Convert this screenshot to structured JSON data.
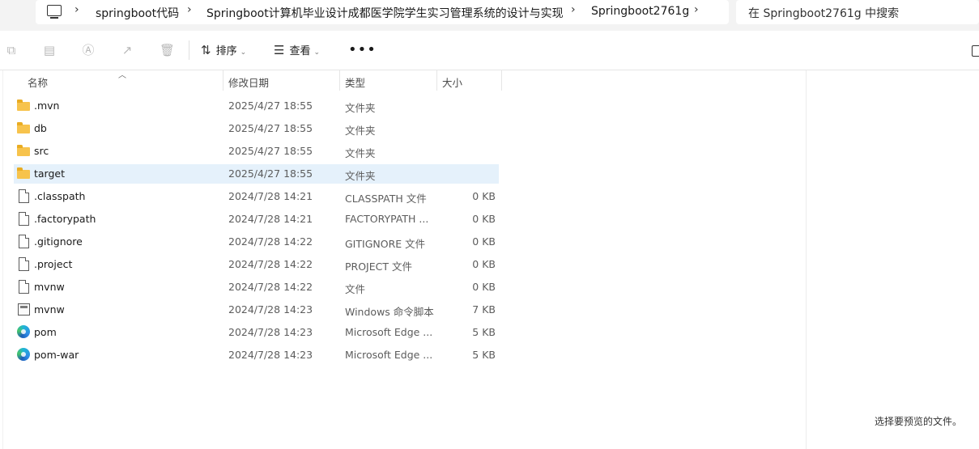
{
  "address": {
    "breadcrumbs": [
      "springboot代码",
      "Springboot计算机毕业设计成都医学院学生实习管理系统的设计与实现",
      "Springboot2761g"
    ],
    "search_placeholder": "在 Springboot2761g 中搜索"
  },
  "toolbar": {
    "sort_label": "排序",
    "view_label": "查看",
    "more_label": "•••"
  },
  "columns": {
    "name": "名称",
    "modified": "修改日期",
    "type": "类型",
    "size": "大小"
  },
  "files": [
    {
      "name": ".mvn",
      "modified": "2025/4/27 18:55",
      "type": "文件夹",
      "size": "",
      "icon": "folder-icon"
    },
    {
      "name": "db",
      "modified": "2025/4/27 18:55",
      "type": "文件夹",
      "size": "",
      "icon": "folder-icon"
    },
    {
      "name": "src",
      "modified": "2025/4/27 18:55",
      "type": "文件夹",
      "size": "",
      "icon": "folder-icon"
    },
    {
      "name": "target",
      "modified": "2025/4/27 18:55",
      "type": "文件夹",
      "size": "",
      "icon": "folder-icon"
    },
    {
      "name": ".classpath",
      "modified": "2024/7/28 14:21",
      "type": "CLASSPATH 文件",
      "size": "0 KB",
      "icon": "file-icon"
    },
    {
      "name": ".factorypath",
      "modified": "2024/7/28 14:21",
      "type": "FACTORYPATH ...",
      "size": "0 KB",
      "icon": "file-icon"
    },
    {
      "name": ".gitignore",
      "modified": "2024/7/28 14:22",
      "type": "GITIGNORE 文件",
      "size": "0 KB",
      "icon": "file-icon"
    },
    {
      "name": ".project",
      "modified": "2024/7/28 14:22",
      "type": "PROJECT 文件",
      "size": "0 KB",
      "icon": "file-icon"
    },
    {
      "name": "mvnw",
      "modified": "2024/7/28 14:22",
      "type": "文件",
      "size": "0 KB",
      "icon": "file-icon"
    },
    {
      "name": "mvnw",
      "modified": "2024/7/28 14:23",
      "type": "Windows 命令脚本",
      "size": "7 KB",
      "icon": "cmd-script-icon"
    },
    {
      "name": "pom",
      "modified": "2024/7/28 14:23",
      "type": "Microsoft Edge ...",
      "size": "5 KB",
      "icon": "edge-icon"
    },
    {
      "name": "pom-war",
      "modified": "2024/7/28 14:23",
      "type": "Microsoft Edge ...",
      "size": "5 KB",
      "icon": "edge-icon"
    }
  ],
  "selected_row": "target",
  "preview": {
    "message": "选择要预览的文件。"
  }
}
